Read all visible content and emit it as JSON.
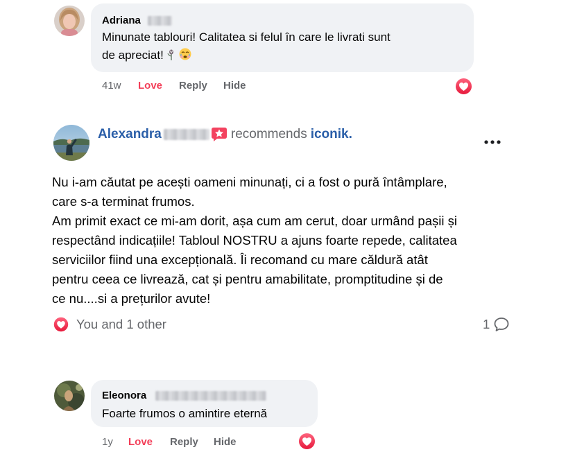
{
  "colors": {
    "bubble": "#f0f2f5",
    "text": "#050505",
    "muted": "#65676b",
    "love": "#f33e58",
    "link": "#2a5ea8"
  },
  "comments": [
    {
      "author": "Adriana",
      "lines": [
        "Minunate tablouri! Calitatea si felul în care le livrati sunt",
        "de apreciat!"
      ],
      "emojis": [
        "rose-emoji",
        "crying-face-emoji"
      ],
      "time": "41w",
      "love_label": "Love",
      "reply_label": "Reply",
      "hide_label": "Hide",
      "reaction": "love-reaction-icon"
    },
    {
      "author": "Eleonora",
      "lines": [
        "Foarte frumos o amintire eternă"
      ],
      "time": "1y",
      "love_label": "Love",
      "reply_label": "Reply",
      "hide_label": "Hide",
      "reaction": "love-reaction-icon"
    }
  ],
  "post": {
    "author": "Alexandra",
    "badge_icon": "recommend-star-icon",
    "verb": "recommends",
    "page": "iconik.",
    "menu_icon": "more-options-icon",
    "body_lines": [
      "Nu i-am căutat pe acești oameni minunați, ci a fost o pură întâmplare,",
      "care s-a terminat frumos.",
      "Am primit exact ce mi-am dorit, așa cum am cerut, doar urmând pașii și",
      "respectând indicațiile! Tabloul NOSTRU a ajuns foarte repede, calitatea",
      "serviciilor fiind una excepțională. Îi recomand cu mare căldură atât",
      "pentru ceea ce livrează, cat și pentru amabilitate, promptitudine și de",
      "ce nu....si a prețurilor avute!"
    ],
    "reaction_icon": "love-reaction-icon",
    "reactions_text": "You and 1 other",
    "comment_count": "1",
    "comment_icon": "comment-icon"
  }
}
